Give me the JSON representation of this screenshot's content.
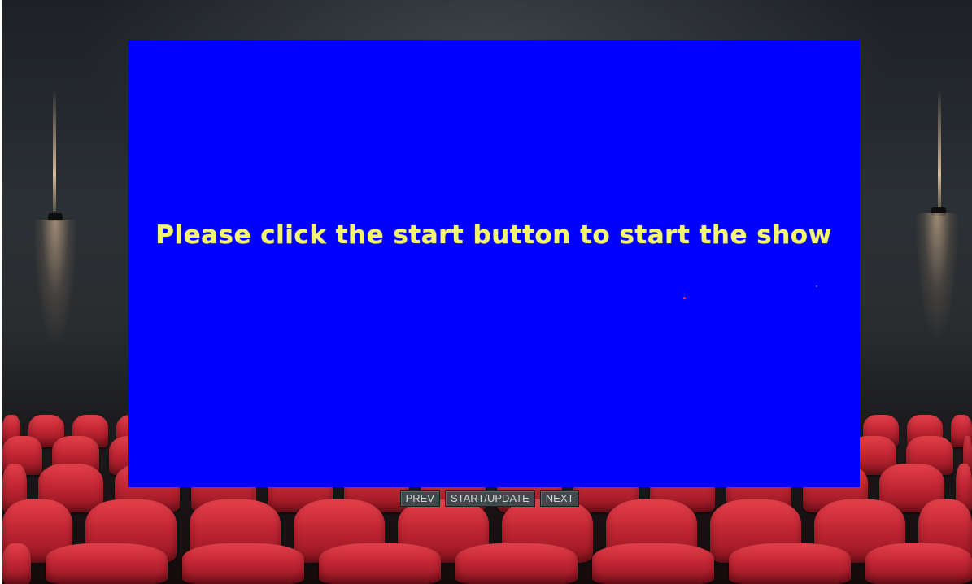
{
  "screen": {
    "message": "Please click the start button to start the show",
    "background_color": "#0000ff",
    "text_color": "#f3f56e"
  },
  "controls": {
    "prev_label": "PREV",
    "start_label": "START/UPDATE",
    "next_label": "NEXT"
  },
  "theme": {
    "seat_color": "#c42734",
    "button_color": "#3e4a4c"
  }
}
